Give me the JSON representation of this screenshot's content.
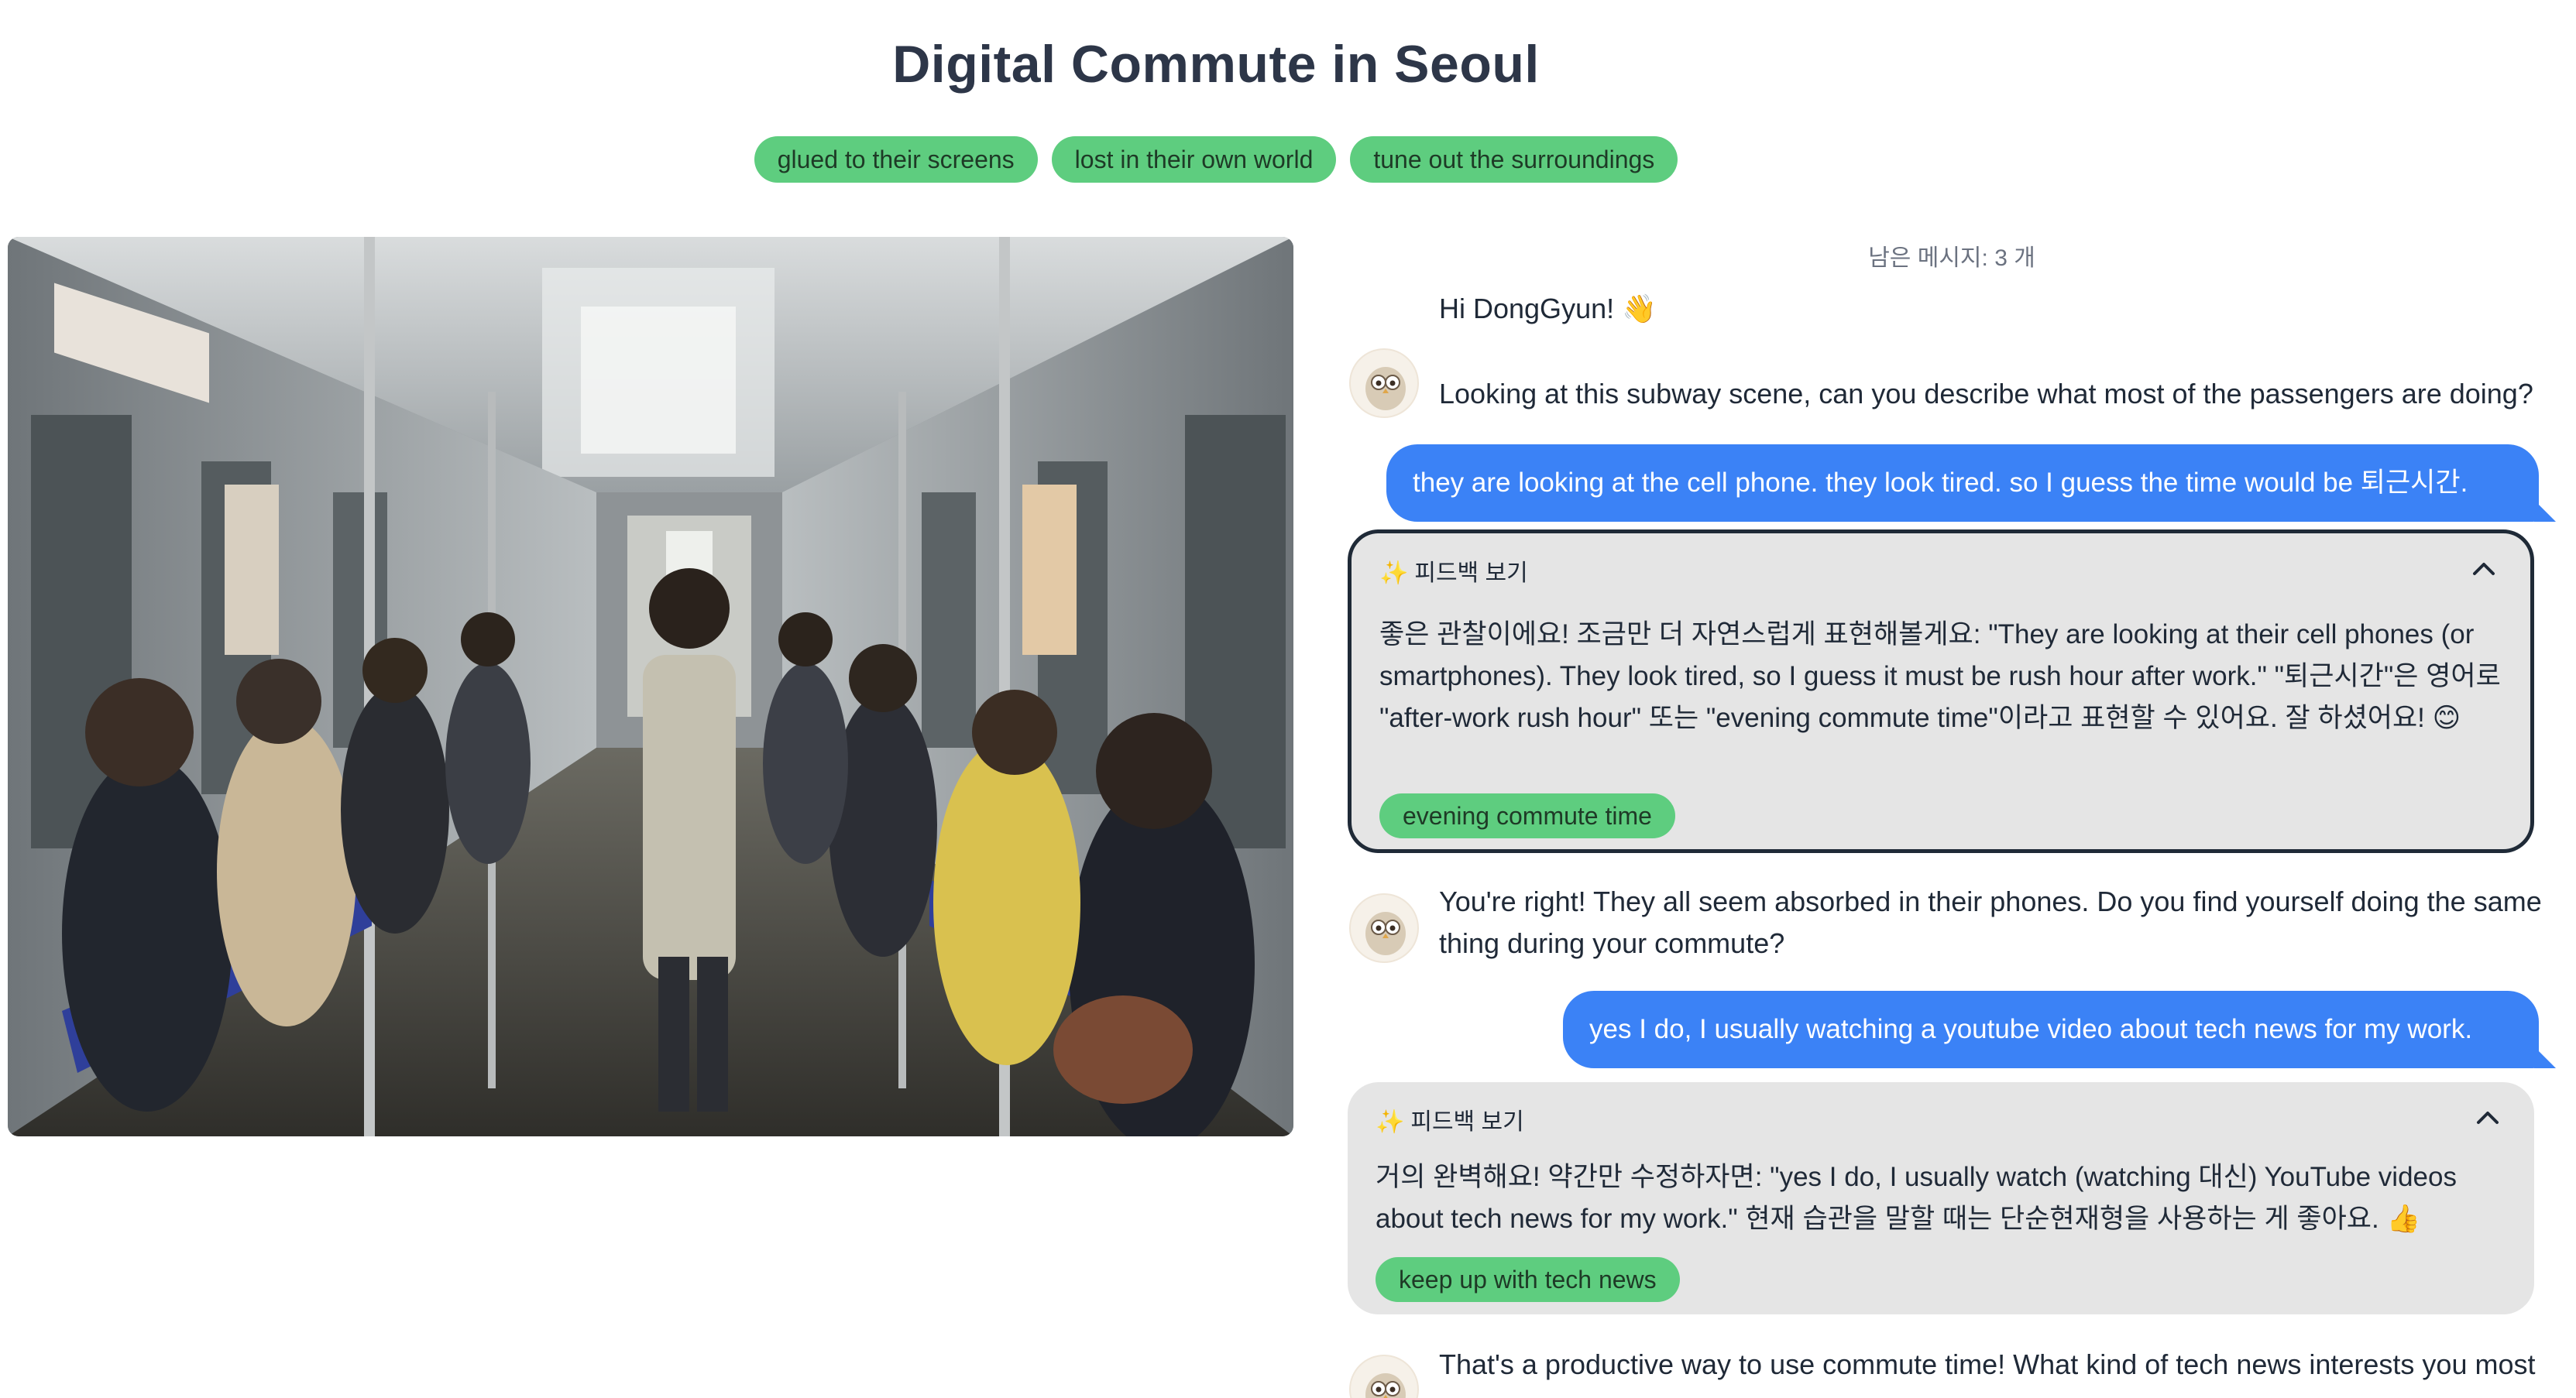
{
  "page": {
    "title": "Digital Commute in Seoul"
  },
  "tags": [
    "glued to their screens",
    "lost in their own world",
    "tune out the surroundings"
  ],
  "photo": {
    "alt": "subway-photo"
  },
  "chat": {
    "remaining": "남은 메시지: 3 개",
    "greeting": "Hi DongGyun! 👋",
    "bot1": "Looking at this subway scene, can you describe what most of the passengers are doing?",
    "user1": "they are looking at the cell phone. they look tired. so I guess the time would be 퇴근시간.",
    "feedback1": {
      "header": "피드백 보기",
      "spark": "✨",
      "text": "좋은 관찰이에요! 조금만 더 자연스럽게 표현해볼게요: \"They are looking at their cell phones (or smartphones). They look tired, so I guess it must be rush hour after work.\" \"퇴근시간\"은 영어로 \"after-work rush hour\" 또는 \"evening commute time\"이라고 표현할 수 있어요. 잘 하셨어요! 😊",
      "chip": "evening commute time"
    },
    "bot2": "You're right! They all seem absorbed in their phones. Do you find yourself doing the same thing during your commute?",
    "user2": "yes I do, I usually watching a youtube video about tech news for my work.",
    "feedback2": {
      "header": "피드백 보기",
      "spark": "✨",
      "text": "거의 완벽해요! 약간만 수정하자면: \"yes I do, I usually watch (watching 대신) YouTube videos about tech news for my work.\" 현재 습관을 말할 때는 단순현재형을 사용하는 게 좋아요. 👍",
      "chip": "keep up with tech news"
    },
    "bot3": "That's a productive way to use commute time! What kind of tech news interests you most"
  }
}
